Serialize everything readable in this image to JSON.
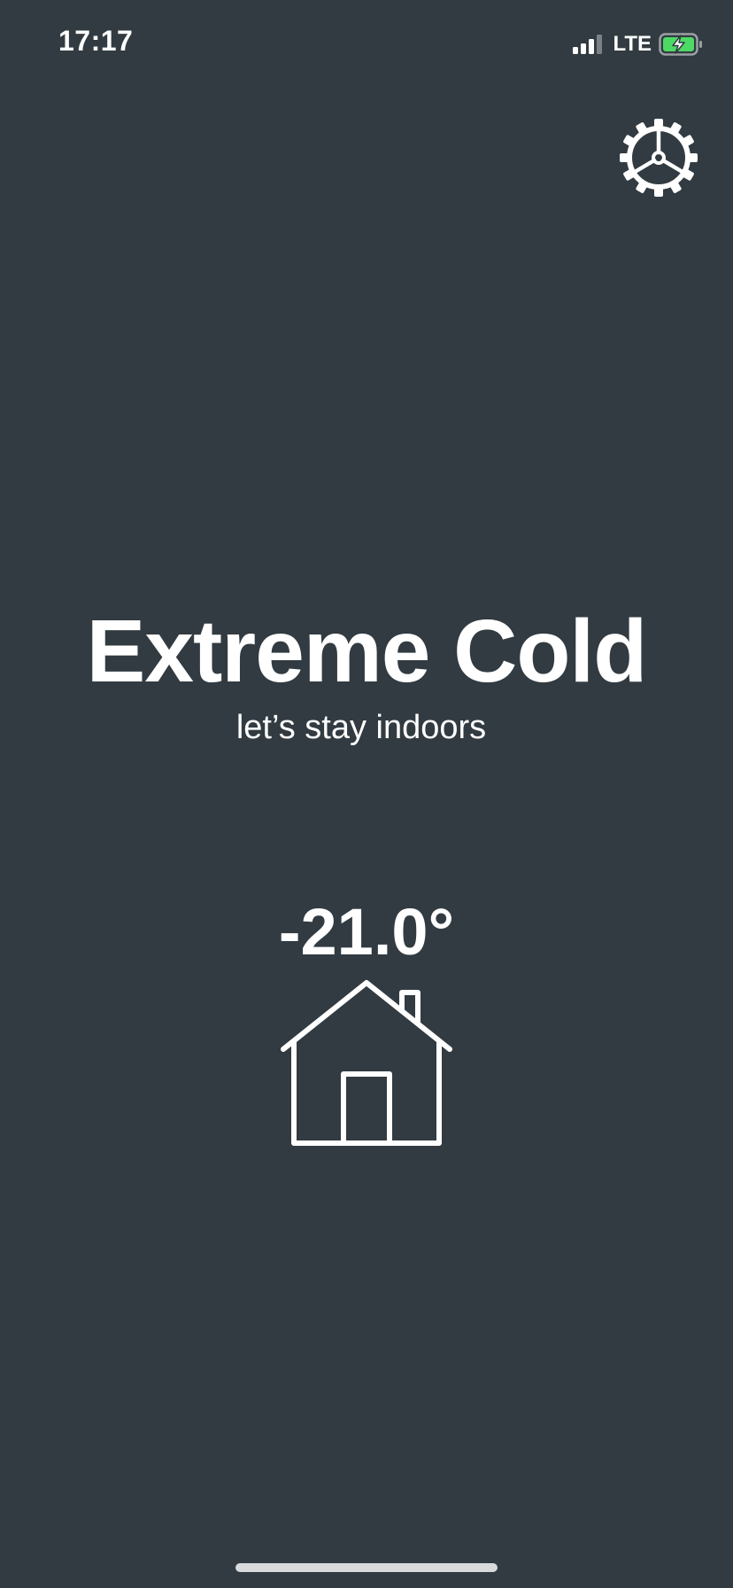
{
  "status_bar": {
    "time": "17:17",
    "network": "LTE",
    "battery_color": "#4cd964",
    "signal_icon": "signal-bars-icon",
    "battery_icon": "battery-charging-icon"
  },
  "settings": {
    "icon": "gear-icon"
  },
  "weather": {
    "condition": "Extreme Cold",
    "advice": "let’s stay indoors",
    "temperature": "-21.0°",
    "location_icon": "house-icon"
  },
  "colors": {
    "background": "#323b41",
    "foreground": "#ffffff"
  }
}
